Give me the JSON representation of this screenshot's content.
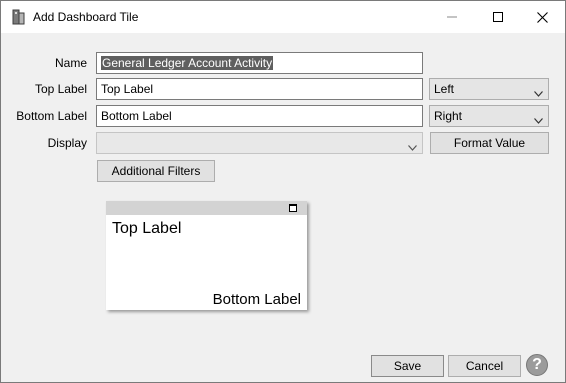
{
  "window": {
    "title": "Add Dashboard Tile",
    "controls": {
      "minimize": "—",
      "maximize": "☐",
      "close": "✕"
    }
  },
  "form": {
    "name": {
      "label": "Name",
      "value": "General Ledger Account Activity"
    },
    "top_label": {
      "label": "Top Label",
      "value": "Top Label",
      "alignment": "Left"
    },
    "bottom_label": {
      "label": "Bottom Label",
      "value": "Bottom Label",
      "alignment": "Right"
    },
    "display": {
      "label": "Display",
      "value": ""
    },
    "format_value_button": "Format Value",
    "additional_filters_button": "Additional Filters"
  },
  "preview": {
    "top_text": "Top Label",
    "bottom_text": "Bottom Label"
  },
  "footer": {
    "save_label": "Save",
    "cancel_label": "Cancel",
    "help_glyph": "?"
  },
  "colors": {
    "dialog_bg": "#f0f0f0",
    "selection_bg": "#5f5f5f",
    "tile_header": "#d3d3d3"
  }
}
